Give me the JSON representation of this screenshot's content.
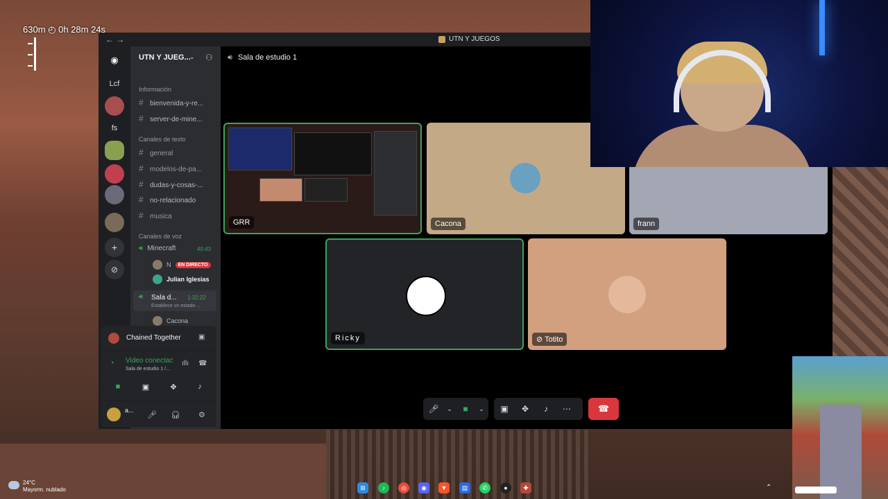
{
  "hud": {
    "distance": "630m",
    "time": "0h 28m 24s"
  },
  "window": {
    "title": "UTN Y JUEGOS"
  },
  "guilds": [
    "Lcf",
    "fs"
  ],
  "server": {
    "name": "UTN Y JUEG..."
  },
  "categories": {
    "info": "Información",
    "text": "Canales de texto",
    "voice": "Canales de voz"
  },
  "info_channels": [
    "bienvenida-y-re...",
    "server-de-mine..."
  ],
  "text_channels": [
    "general",
    "modelos-de-pa...",
    "dudas-y-cosas-...",
    "no-relacionado",
    "musica"
  ],
  "voice_channels": {
    "minecraft": {
      "name": "Minecraft",
      "time": "40:43",
      "users": [
        {
          "name": "N",
          "badge": "EN DIRECTO"
        },
        {
          "name": "Julian Iglesias"
        }
      ]
    },
    "sala": {
      "name": "Sala d...",
      "time": "1:32:22",
      "status": "Establece un estado ...",
      "users": [
        "Cacona"
      ]
    }
  },
  "activity": {
    "name": "Chained Together"
  },
  "voice_conn": {
    "title": "Video conectac",
    "subtitle": "Sala de estudio 1 /..."
  },
  "user": {
    "name": "a..."
  },
  "call": {
    "channel": "Sala de estudio 1"
  },
  "tiles": {
    "grr": "GRR",
    "cacona": "Cacona",
    "frann": "frann",
    "ricky": "Ricky",
    "totito": "Totito"
  },
  "weather": {
    "temp": "24°C",
    "desc": "Mayorm. nublado"
  },
  "colors": {
    "accent_green": "#3ba55d",
    "hangup_red": "#da373c",
    "live_red": "#da373c"
  },
  "icons": [
    "discord-icon",
    "speaker-icon",
    "hash-icon",
    "mic-icon",
    "video-icon",
    "screen-share-icon",
    "activity-icon",
    "hangup-icon",
    "gear-icon",
    "headphones-icon"
  ]
}
